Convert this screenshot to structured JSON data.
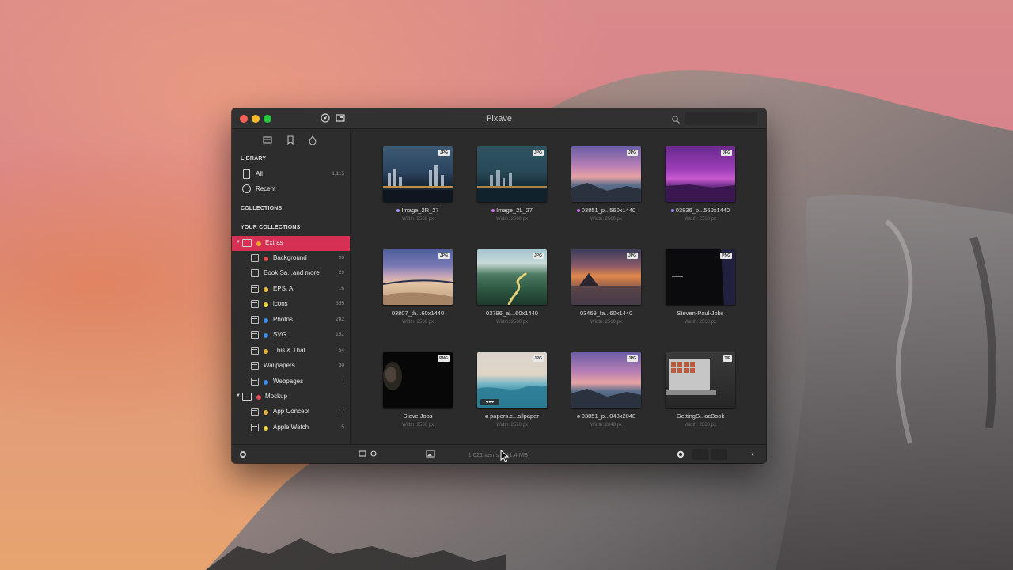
{
  "window": {
    "title": "Pixave",
    "search_placeholder": ""
  },
  "sidebar": {
    "tabs": [
      "collection-icon",
      "tag-icon",
      "drop-icon"
    ],
    "library_header": "LIBRARY",
    "library_items": [
      {
        "label": "All",
        "count": "1,115",
        "icon": "document-icon"
      },
      {
        "label": "Recent",
        "count": "",
        "icon": "clock-icon"
      }
    ],
    "collections_header": "COLLECTIONS",
    "your_collections_header": "YOUR COLLECTIONS",
    "collections": [
      {
        "label": "Extras",
        "count": "",
        "dot": "#f2a02e",
        "group": true,
        "selected": true
      },
      {
        "label": "Background",
        "count": "96",
        "dot": "#e5484d"
      },
      {
        "label": "Book Sa...and more",
        "count": "29",
        "dot": ""
      },
      {
        "label": "EPS, AI",
        "count": "16",
        "dot": "#e9b53a"
      },
      {
        "label": "icons",
        "count": "355",
        "dot": "#e5d23c"
      },
      {
        "label": "Photos",
        "count": "282",
        "dot": "#3d8ee8"
      },
      {
        "label": "SVG",
        "count": "152",
        "dot": "#3d8ee8"
      },
      {
        "label": "This & That",
        "count": "54",
        "dot": "#e9b53a"
      },
      {
        "label": "Wallpapers",
        "count": "30",
        "dot": ""
      },
      {
        "label": "Webpages",
        "count": "1",
        "dot": "#3d8ee8"
      },
      {
        "label": "Mockup",
        "count": "",
        "dot": "#e5484d",
        "group": true
      },
      {
        "label": "App Concept",
        "count": "17",
        "dot": "#e9b53a"
      },
      {
        "label": "Apple Watch",
        "count": "5",
        "dot": "#e5d23c"
      }
    ]
  },
  "grid": {
    "items": [
      {
        "name": "Image_2R_27",
        "sub": "Width: 2560 px",
        "badge": "JPG",
        "dot": "#9a8cf5",
        "thumb": "city-night-1"
      },
      {
        "name": "Image_2L_27",
        "sub": "Width: 2560 px",
        "badge": "JPG",
        "dot": "#c06ee0",
        "thumb": "city-night-2"
      },
      {
        "name": "03851_p...560x1440",
        "sub": "Width: 2560 px",
        "badge": "JPG",
        "dot": "#c06ee0",
        "thumb": "sunset-rocks"
      },
      {
        "name": "03836_p...560x1440",
        "sub": "Width: 2560 px",
        "badge": "JPG",
        "dot": "#9a8cf5",
        "thumb": "purple-sky"
      },
      {
        "name": "03807_th...60x1440",
        "sub": "Width: 2560 px",
        "badge": "JPG",
        "dot": "",
        "thumb": "beach-bridge"
      },
      {
        "name": "03796_al...60x1440",
        "sub": "Width: 2560 px",
        "badge": "JPG",
        "dot": "",
        "thumb": "green-road"
      },
      {
        "name": "03469_fa...60x1440",
        "sub": "Width: 2560 px",
        "badge": "JPG",
        "dot": "",
        "thumb": "lake-sunset"
      },
      {
        "name": "Steven-Paul-Jobs",
        "sub": "Width: 2560 px",
        "badge": "PNG",
        "dot": "",
        "thumb": "dark-1"
      },
      {
        "name": "Steve Jobs",
        "sub": "Width: 2560 px",
        "badge": "PNG",
        "dot": "",
        "thumb": "dark-portrait"
      },
      {
        "name": "papers.c...allpaper",
        "sub": "Width: 2520 px",
        "badge": "JPG",
        "dot": "#9a9a9a",
        "thumb": "wave",
        "more": "●●●"
      },
      {
        "name": "03851_p...048x2048",
        "sub": "Width: 2048 px",
        "badge": "JPG",
        "dot": "#9a9a9a",
        "thumb": "sunset-rocks"
      },
      {
        "name": "GettingS...acBook",
        "sub": "Width: 2880 px",
        "badge": "TIF",
        "dot": "",
        "thumb": "macbook"
      }
    ]
  },
  "bottombar": {
    "status": "1,021 items (341.4 MB)",
    "left_icon": "gear-icon",
    "view_icons": [
      "grid-icon",
      "info-icon",
      "photo-icon"
    ],
    "right_icons": [
      "settings-icon",
      "segment-1",
      "segment-2",
      "back-chevron-icon"
    ]
  },
  "colors": {
    "accent": "#d63155",
    "window_bg": "#2b2b2b",
    "sidebar_bg": "#2d2d2d"
  }
}
